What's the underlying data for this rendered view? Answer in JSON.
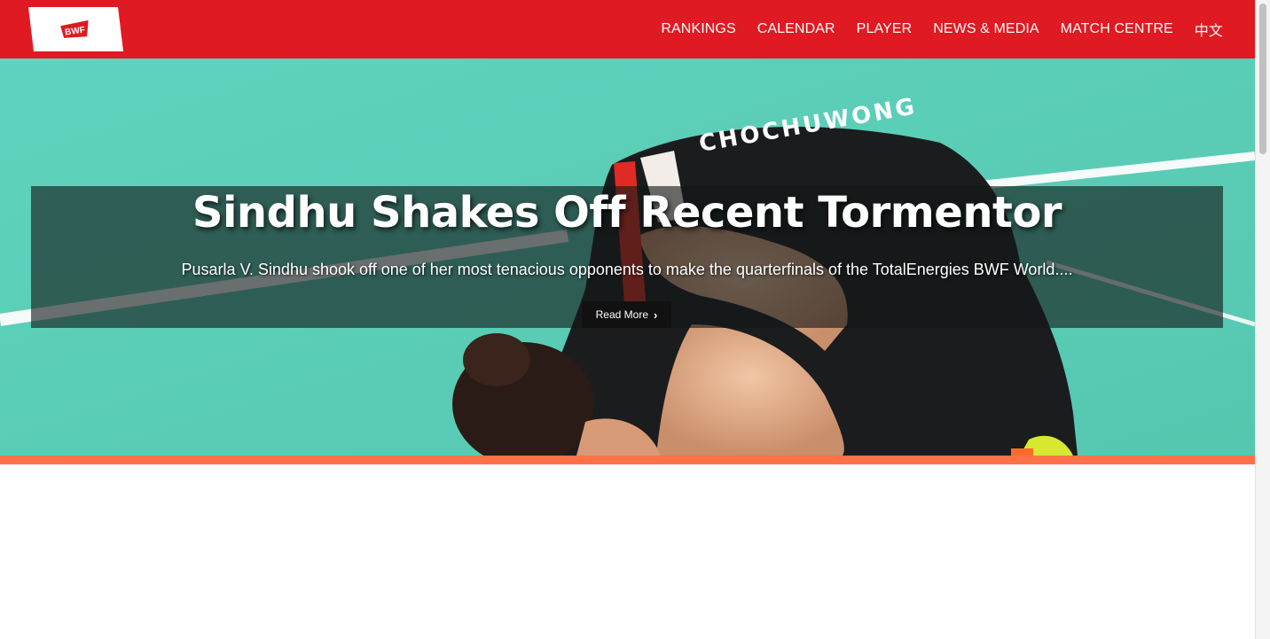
{
  "header": {
    "logo_text": "BWF",
    "nav": [
      "RANKINGS",
      "CALENDAR",
      "PLAYER",
      "NEWS & MEDIA",
      "MATCH CENTRE",
      "中文"
    ]
  },
  "hero": {
    "title": "Sindhu Shakes Off Recent Tormentor",
    "summary": "Pusarla V. Sindhu shook off one of her most tenacious opponents to make the quarterfinals of the TotalEnergies BWF World....",
    "read_more_label": "Read More",
    "read_more_icon": "chevron-right-icon",
    "jersey_text": "CHOCHUWONG"
  },
  "colors": {
    "brand_red": "#e01a22",
    "accent_orange": "#ff7249",
    "court_teal": "#5fcfb9"
  }
}
